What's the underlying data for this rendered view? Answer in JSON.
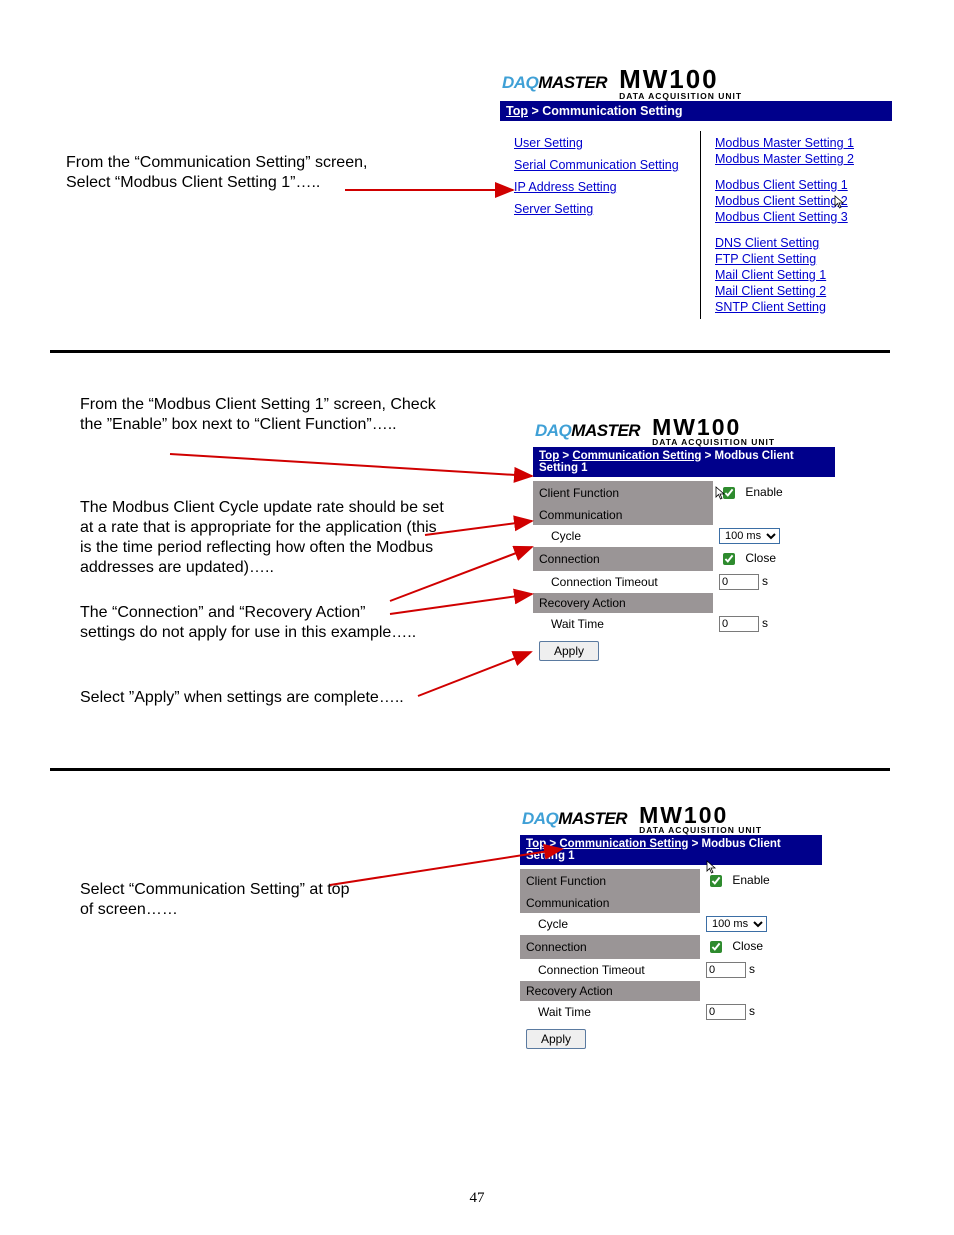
{
  "page_number": "47",
  "logo": {
    "daq": "DAQ",
    "master": "MASTER",
    "mw100": "MW100",
    "subtitle": "DATA ACQUISITION UNIT"
  },
  "section1": {
    "instr": "From the “Communication Setting” screen, Select “Modbus Client Setting 1”…..",
    "breadcrumb_top": "Top",
    "breadcrumb_sep": " > ",
    "breadcrumb_current": "Communication Setting",
    "links_left": [
      "User Setting",
      "Serial Communication Setting",
      "IP Address Setting",
      "Server Setting"
    ],
    "links_right_a": [
      "Modbus Master Setting 1",
      "Modbus Master Setting 2"
    ],
    "links_right_b": [
      "Modbus Client Setting 1",
      "Modbus Client Setting 2",
      "Modbus Client Setting 3"
    ],
    "links_right_c": [
      "DNS Client Setting",
      "FTP Client Setting",
      "Mail Client Setting 1",
      "Mail Client Setting 2",
      "SNTP Client Setting"
    ]
  },
  "section2": {
    "instr1": "From the “Modbus Client Setting 1” screen, Check the ”Enable” box next to “Client Function”…..",
    "instr2": "The Modbus Client Cycle update rate should be set at a rate that is appropriate for the application (this is the time period reflecting how often the Modbus addresses are updated)…..",
    "instr3": "The “Connection” and “Recovery Action” settings do not apply for use in this example…..",
    "instr4": "Select ”Apply” when settings are complete…..",
    "breadcrumb_top": "Top",
    "breadcrumb_comm": "Communication Setting",
    "breadcrumb_current": "Modbus Client Setting 1",
    "breadcrumb_sep": " > ",
    "rows": {
      "client_function": "Client Function",
      "enable": "Enable",
      "communication": "Communication",
      "cycle": "Cycle",
      "cycle_value": "100 ms",
      "connection": "Connection",
      "close": "Close",
      "connection_timeout": "Connection Timeout",
      "timeout_value": "0",
      "timeout_unit": "s",
      "recovery_action": "Recovery Action",
      "wait_time": "Wait Time",
      "wait_value": "0",
      "wait_unit": "s"
    },
    "apply": "Apply"
  },
  "section3": {
    "instr": "Select “Communication Setting” at top of screen……",
    "breadcrumb_top": "Top",
    "breadcrumb_comm": "Communication Setting",
    "breadcrumb_current": "Modbus Client Setting 1",
    "breadcrumb_sep": " > ",
    "rows": {
      "client_function": "Client Function",
      "enable": "Enable",
      "communication": "Communication",
      "cycle": "Cycle",
      "cycle_value": "100 ms",
      "connection": "Connection",
      "close": "Close",
      "connection_timeout": "Connection Timeout",
      "timeout_value": "0",
      "timeout_unit": "s",
      "recovery_action": "Recovery Action",
      "wait_time": "Wait Time",
      "wait_value": "0",
      "wait_unit": "s"
    },
    "apply": "Apply"
  }
}
